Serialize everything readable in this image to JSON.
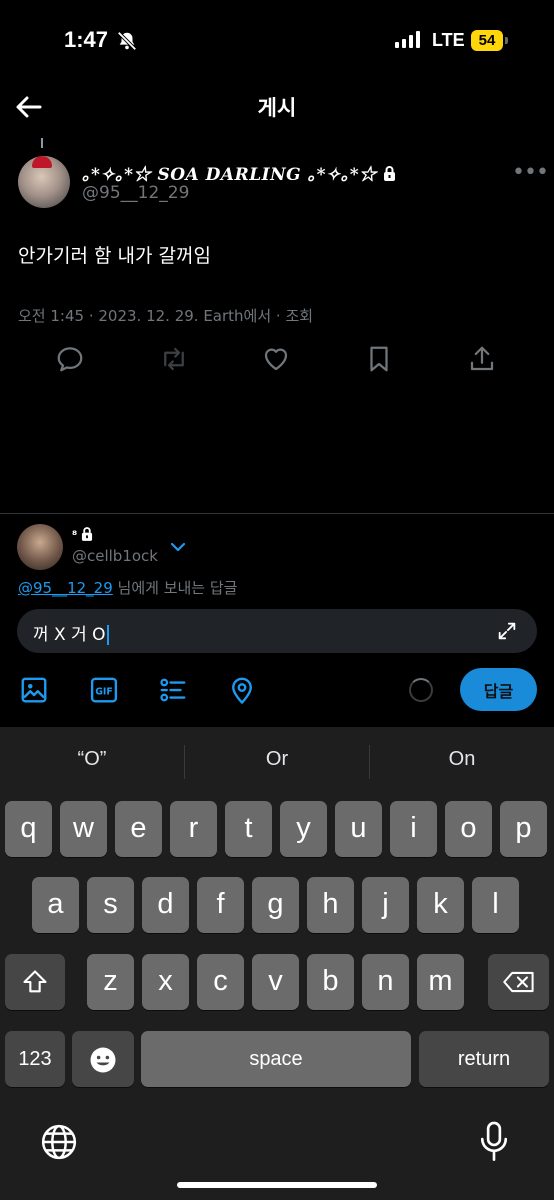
{
  "status_bar": {
    "time": "1:47",
    "network": "LTE",
    "battery": "54"
  },
  "header": {
    "title": "게시"
  },
  "post": {
    "display_name": "｡*✧｡*☆ SOA DARLING ｡*✧｡*☆",
    "handle": "@95__12_29",
    "text": "안가기러 함 내가 갈꺼임",
    "meta": "오전 1:45 · 2023. 12. 29. Earth에서 · 조회"
  },
  "composer": {
    "display_name": "⁸",
    "handle": "@cellb1ock",
    "replying_mention": "@95__12_29",
    "replying_suffix": " 님에게 보내는 답글",
    "input_value": "꺼 X 거 O",
    "reply_button": "답글"
  },
  "keyboard": {
    "suggestions": [
      "“O”",
      "Or",
      "On"
    ],
    "row1": [
      "q",
      "w",
      "e",
      "r",
      "t",
      "y",
      "u",
      "i",
      "o",
      "p"
    ],
    "row2": [
      "a",
      "s",
      "d",
      "f",
      "g",
      "h",
      "j",
      "k",
      "l"
    ],
    "row3": [
      "z",
      "x",
      "c",
      "v",
      "b",
      "n",
      "m"
    ],
    "numbers_key": "123",
    "space_key": "space",
    "return_key": "return"
  },
  "colors": {
    "accent": "#1d9bf0",
    "muted": "#71767b",
    "battery": "#ffd60a"
  },
  "icons": [
    "bell-slash-icon",
    "back-arrow-icon",
    "lock-icon",
    "more-icon",
    "reply-icon",
    "repost-icon",
    "like-icon",
    "bookmark-icon",
    "share-icon",
    "chevron-down-icon",
    "expand-icon",
    "image-icon",
    "gif-icon",
    "poll-icon",
    "location-icon",
    "shift-icon",
    "backspace-icon",
    "emoji-icon",
    "globe-icon",
    "mic-icon"
  ]
}
